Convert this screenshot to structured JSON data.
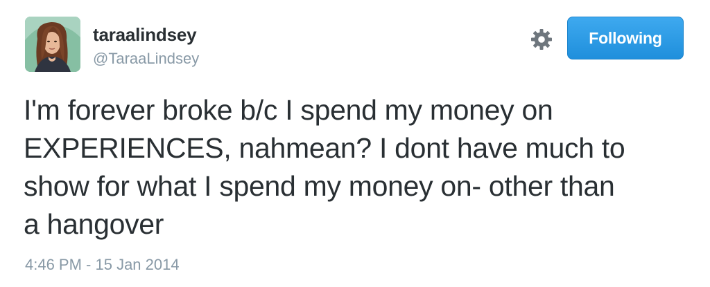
{
  "author": {
    "display_name": "taraalindsey",
    "screen_name": "@TaraaLindsey",
    "avatar_icon": "profile-photo"
  },
  "actions": {
    "settings_icon": "gear-icon",
    "follow_label": "Following",
    "follow_color": "#2b9ee8"
  },
  "tweet": {
    "lines": [
      "I'm forever broke b/c I spend my money on",
      "EXPERIENCES, nahmean? I dont have much to",
      "show for what I spend my money on- other than",
      "a hangover"
    ],
    "timestamp": "4:46 PM - 15 Jan 2014"
  }
}
